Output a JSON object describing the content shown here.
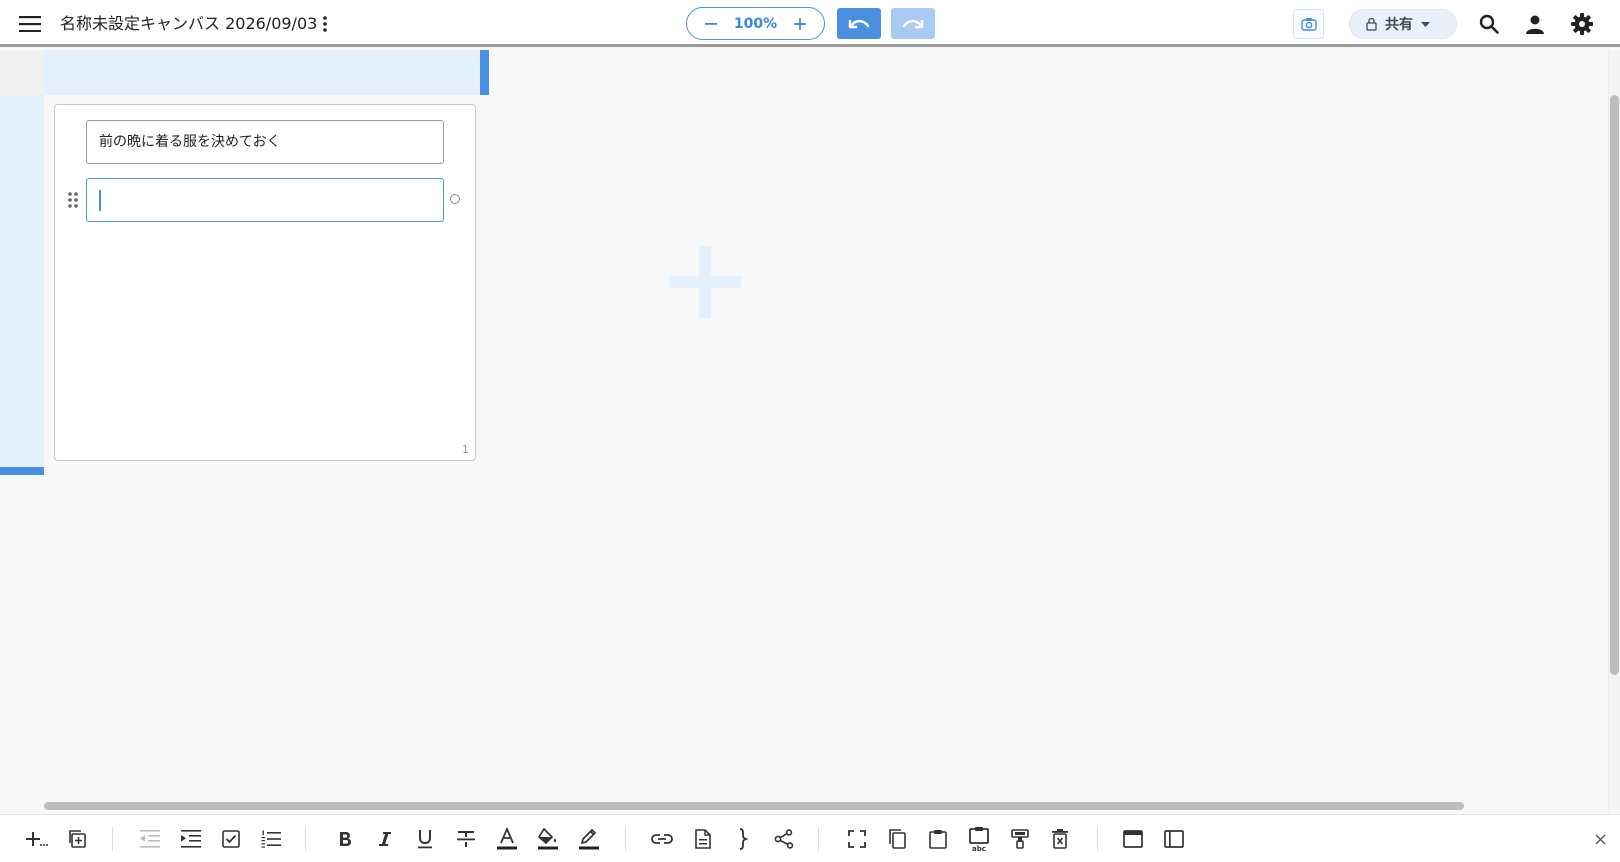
{
  "header": {
    "title": "名称未設定キャンバス 2026/09/03",
    "zoom": "100%",
    "share_label": "共有"
  },
  "card": {
    "items": [
      {
        "text": "前の晩に着る服を決めておく"
      },
      {
        "text": ""
      }
    ],
    "page_number": "1"
  },
  "toolbar": {
    "groups": [
      [
        "add-item",
        "duplicate"
      ],
      [
        "outdent",
        "indent",
        "checkbox",
        "numbered-list"
      ],
      [
        "bold",
        "italic",
        "underline",
        "strikethrough",
        "text-color",
        "fill-color",
        "highlight"
      ],
      [
        "link",
        "document",
        "brace",
        "connector"
      ],
      [
        "fit-screen",
        "copy",
        "paste",
        "paste-text",
        "format-painter",
        "delete"
      ],
      [
        "window",
        "sidebar"
      ]
    ]
  },
  "colors": {
    "accent": "#4a90e2",
    "band": "#e4f1fc",
    "redo_disabled": "#a7cbf3"
  }
}
